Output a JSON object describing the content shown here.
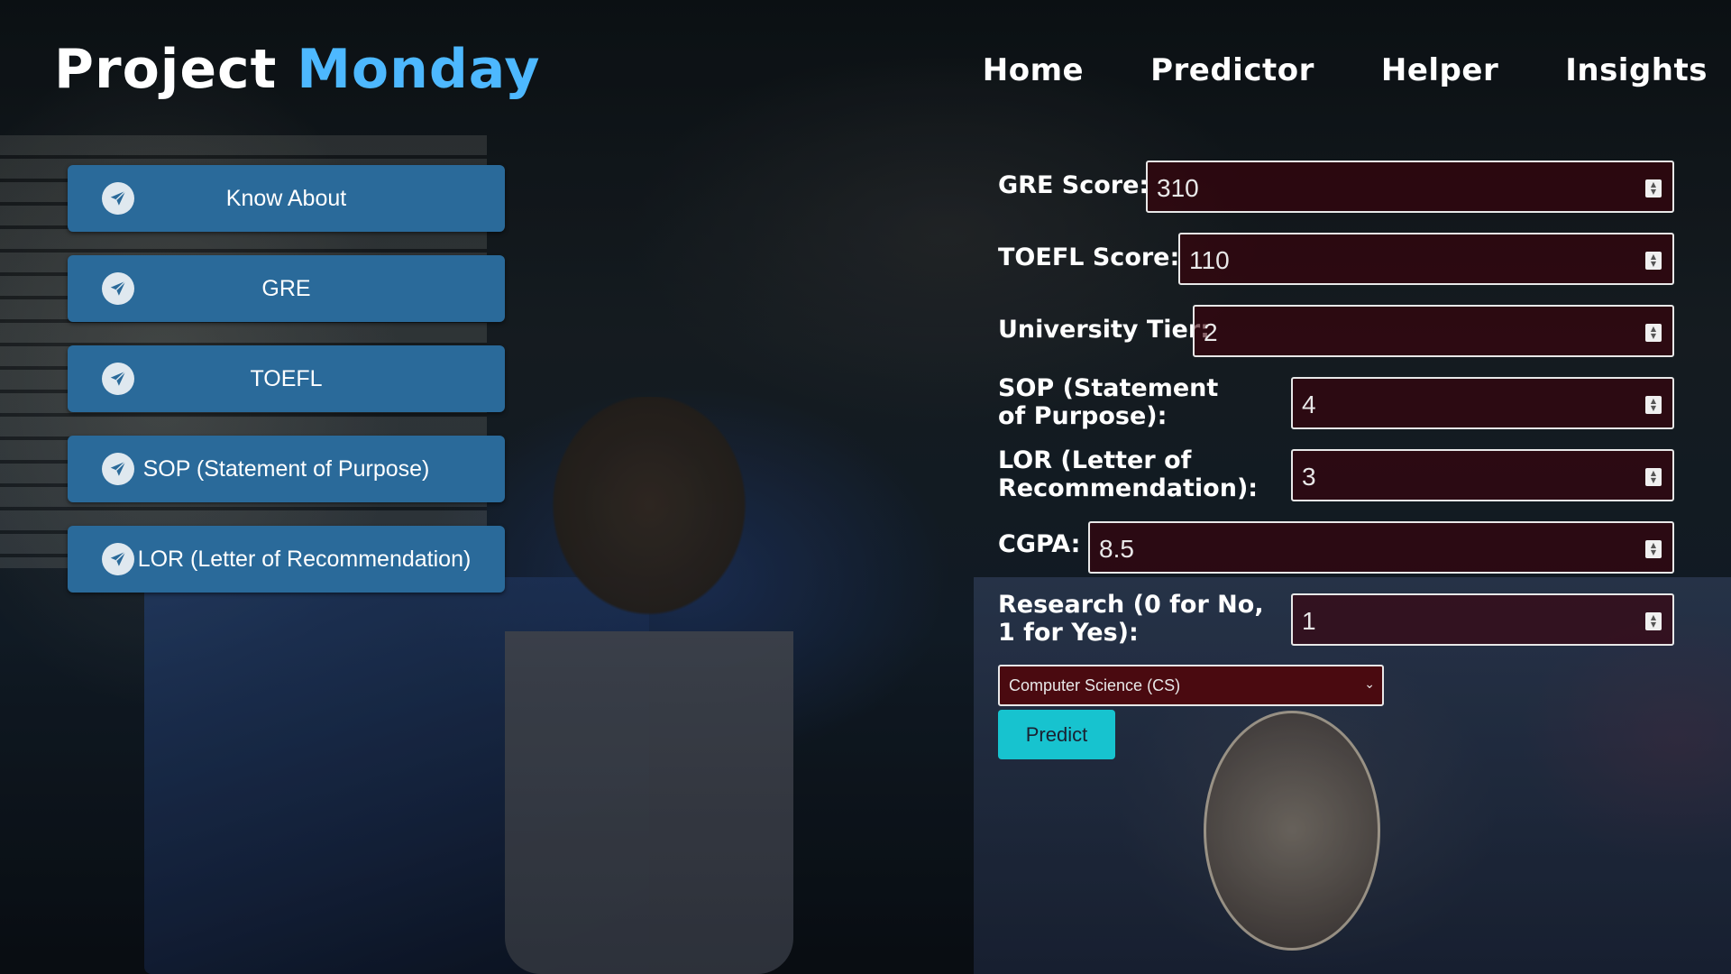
{
  "brand": {
    "part1": "Project",
    "part2": "Monday"
  },
  "nav": {
    "items": [
      "Home",
      "Predictor",
      "Helper",
      "Insights"
    ]
  },
  "sidebar": {
    "items": [
      {
        "label": "Know About",
        "icon": "paper-plane-icon"
      },
      {
        "label": "GRE",
        "icon": "paper-plane-icon"
      },
      {
        "label": "TOEFL",
        "icon": "paper-plane-icon"
      },
      {
        "label": "SOP (Statement of Purpose)",
        "icon": "paper-plane-icon"
      },
      {
        "label": "LOR (Letter of Recommendation)",
        "icon": "paper-plane-icon"
      }
    ]
  },
  "form": {
    "fields": [
      {
        "label": "GRE Score:",
        "value": "310"
      },
      {
        "label": "TOEFL Score:",
        "value": "110"
      },
      {
        "label": "University Tier:",
        "value": "2"
      },
      {
        "label": "SOP (Statement of Purpose):",
        "value": "4"
      },
      {
        "label": "LOR (Letter of Recommendation):",
        "value": "3"
      },
      {
        "label": "CGPA:",
        "value": "8.5"
      },
      {
        "label": "Research (0 for No, 1 for Yes):",
        "value": "1"
      }
    ],
    "course_select": {
      "value": "Computer Science (CS)"
    },
    "predict_label": "Predict"
  },
  "colors": {
    "accent_blue": "#4db8ff",
    "sidebar_button": "#2a6a9a",
    "predict_button": "#17c3cf",
    "field_bg": "#3c000a"
  }
}
